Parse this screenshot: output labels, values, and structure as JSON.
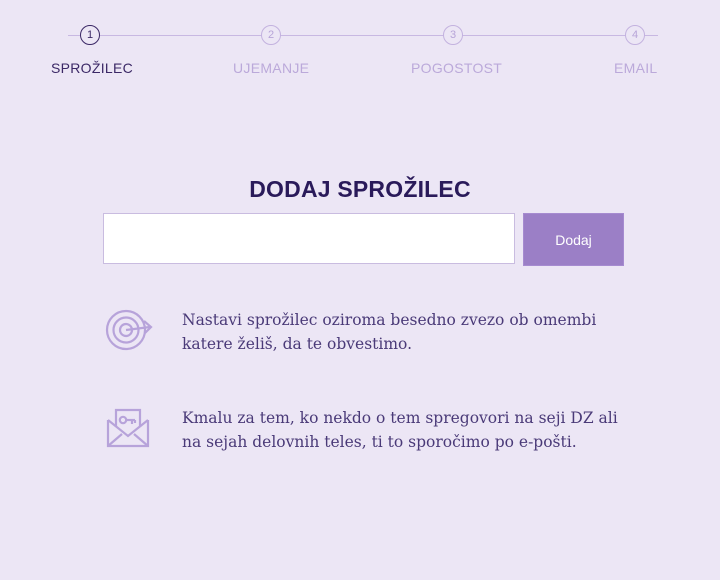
{
  "steps": [
    {
      "number": "1",
      "label": "SPROŽILEC",
      "active": true
    },
    {
      "number": "2",
      "label": "UJEMANJE",
      "active": false
    },
    {
      "number": "3",
      "label": "POGOSTOST",
      "active": false
    },
    {
      "number": "4",
      "label": "EMAIL",
      "active": false
    }
  ],
  "main": {
    "title": "DODAJ SPROŽILEC",
    "input_value": "",
    "input_placeholder": "",
    "add_label": "Dodaj"
  },
  "info": [
    {
      "icon": "target-icon",
      "text": "Nastavi sprožilec oziroma besedno zvezo ob omembi katere želiš, da te obvestimo."
    },
    {
      "icon": "envelope-key-icon",
      "text": "Kmalu za tem, ko nekdo o tem spregovori na seji DZ ali na sejah delovnih teles, ti to sporočimo po e-pošti."
    }
  ],
  "colors": {
    "accent": "#9b7fc6",
    "background": "#ece6f5",
    "text": "#2a1a5a"
  }
}
